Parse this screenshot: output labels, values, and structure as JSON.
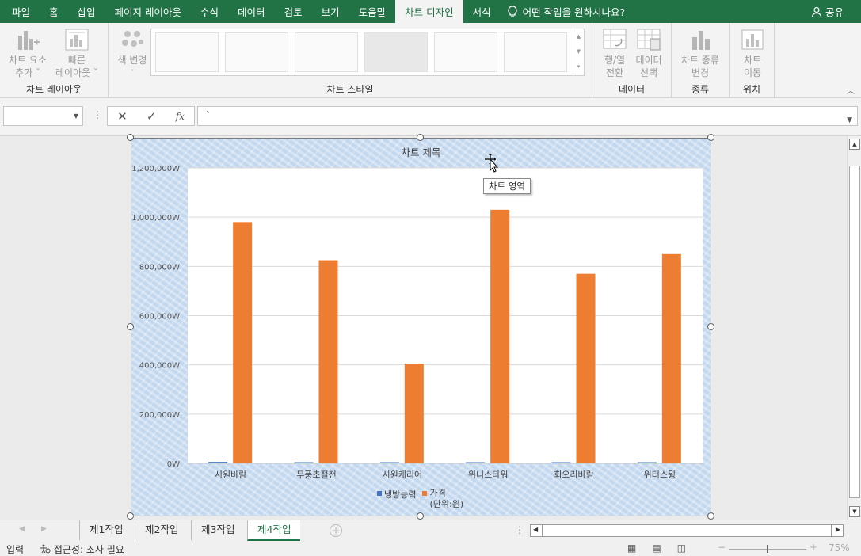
{
  "ribbon_tabs": [
    "파일",
    "홈",
    "삽입",
    "페이지 레이아웃",
    "수식",
    "데이터",
    "검토",
    "보기",
    "도움말",
    "차트 디자인",
    "서식"
  ],
  "active_tab": "차트 디자인",
  "tell_me": "어떤 작업을 원하시나요?",
  "share": "공유",
  "ribbon": {
    "add_element": [
      "차트 요소",
      "추가 ˅"
    ],
    "quick_layout": [
      "빠른",
      "레이아웃 ˅"
    ],
    "group_layout": "차트 레이아웃",
    "change_colors": "색 변경",
    "group_styles": "차트 스타일",
    "switch_row_col": [
      "행/열",
      "전환"
    ],
    "select_data": [
      "데이터",
      "선택"
    ],
    "group_data": "데이터",
    "change_type": [
      "차트 종류",
      "변경"
    ],
    "group_type": "종류",
    "move_chart": [
      "차트",
      "이동"
    ],
    "group_location": "위치"
  },
  "formula": {
    "name_box": "",
    "value": "`"
  },
  "chart": {
    "tooltip": "차트 영역",
    "accent_colors": {
      "series1": "#4472C4",
      "series2": "#ED7D31"
    }
  },
  "chart_data": {
    "type": "bar",
    "title": "차트 제목",
    "categories": [
      "시원바람",
      "무풍초절전",
      "시원캐리어",
      "위니스타워",
      "회오리바람",
      "위터스윙"
    ],
    "series": [
      {
        "name": "냉방능력",
        "values": [
          6000,
          4000,
          4000,
          4000,
          4000,
          4000
        ]
      },
      {
        "name": "가격\n(단위:원)",
        "values": [
          980000,
          825000,
          405000,
          1030000,
          770000,
          850000
        ]
      }
    ],
    "ylim": [
      0,
      1200000
    ],
    "yticks": [
      "0W",
      "200,000W",
      "400,000W",
      "600,000W",
      "800,000W",
      "1,000,000W",
      "1,200,000W"
    ],
    "grid": true,
    "legend": "bottom"
  },
  "sheet_tabs": [
    "제1작업",
    "제2작업",
    "제3작업",
    "제4작업"
  ],
  "active_sheet": "제4작업",
  "status": {
    "mode": "입력",
    "accessibility": "접근성: 조사 필요",
    "zoom": "75%"
  }
}
